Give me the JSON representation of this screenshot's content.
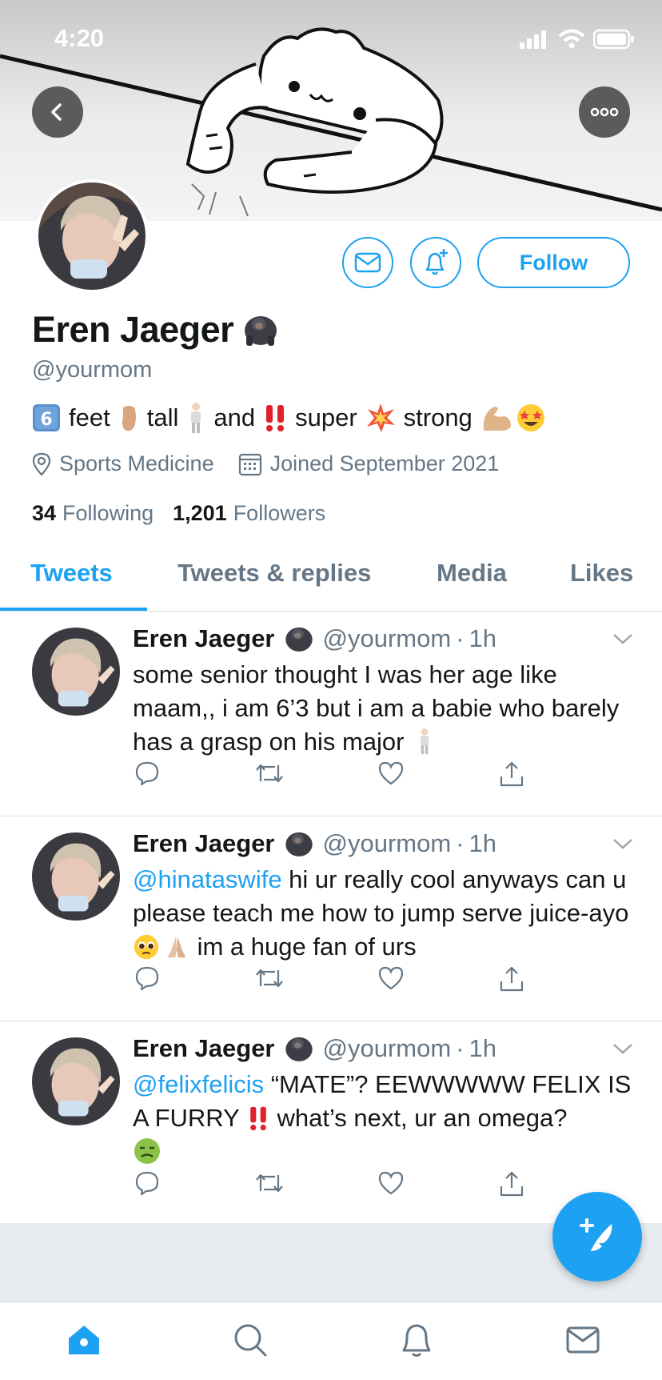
{
  "status_bar": {
    "time": "4:20"
  },
  "profile": {
    "name": "Eren Jaeger",
    "name_emoji": "gorilla-emoji",
    "handle": "@yourmom",
    "follow_label": "Follow",
    "bio": {
      "words": [
        "feet",
        "tall",
        "and",
        "super",
        "strong"
      ],
      "emojis": [
        "keycap-6-emoji",
        "foot-emoji",
        "standing-man-emoji",
        "double-exclamation-emoji",
        "collision-emoji",
        "flexed-biceps-emoji",
        "star-struck-emoji"
      ]
    },
    "location": "Sports Medicine",
    "joined": "Joined September 2021",
    "following_count": "34",
    "following_label": "Following",
    "followers_count": "1,201",
    "followers_label": "Followers"
  },
  "tabs": [
    {
      "label": "Tweets",
      "active": true
    },
    {
      "label": "Tweets & replies",
      "active": false
    },
    {
      "label": "Media",
      "active": false
    },
    {
      "label": "Likes",
      "active": false
    }
  ],
  "tweets": [
    {
      "name": "Eren Jaeger",
      "handle": "@yourmom",
      "time": "1h",
      "text_1": "some senior thought I was her age like maam,, i am 6’3 but i am a babie who barely has a grasp on his major"
    },
    {
      "name": "Eren Jaeger",
      "handle": "@yourmom",
      "time": "1h",
      "mention": "@hinataswife",
      "text_1": " hi ur really cool anyways can u please teach me how to jump serve juice-ayo ",
      "text_2": " im a huge fan of urs"
    },
    {
      "name": "Eren Jaeger",
      "handle": "@yourmom",
      "time": "1h",
      "mention": "@felixfelicis",
      "text_1": " “MATE”? EEWWWWW FELIX IS A FURRY ",
      "text_2": " what’s next, ur an omega?"
    }
  ],
  "colors": {
    "accent": "#1da1f2",
    "secondary_text": "#657786",
    "divider": "#d8dde1"
  },
  "icons": [
    "back-arrow-icon",
    "more-icon",
    "envelope-icon",
    "bell-plus-icon",
    "location-pin-icon",
    "calendar-icon",
    "reply-icon",
    "retweet-icon",
    "like-icon",
    "share-icon",
    "compose-icon",
    "home-icon",
    "search-icon",
    "notifications-icon",
    "messages-icon"
  ]
}
